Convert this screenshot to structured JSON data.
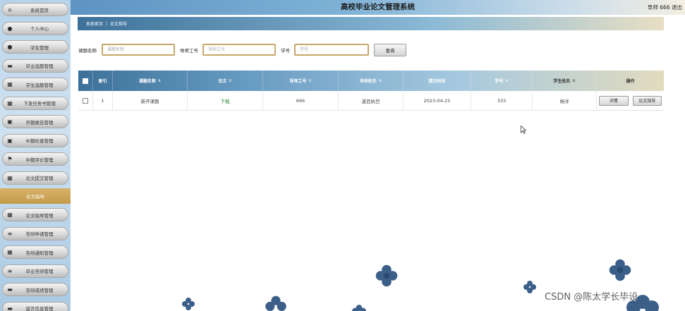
{
  "header": {
    "title": "高校毕业论文管理系统",
    "user": "导师 666 退出"
  },
  "breadcrumb": {
    "home": "系统首页",
    "current": "论文指导"
  },
  "sidebar": {
    "items": [
      {
        "label": "系统首页",
        "icon": "home-icon"
      },
      {
        "label": "个人中心",
        "icon": "user-icon"
      },
      {
        "label": "学生管理",
        "icon": "user-icon"
      },
      {
        "label": "毕业选题管理",
        "icon": "book-icon"
      },
      {
        "label": "学生选题管理",
        "icon": "grid-icon"
      },
      {
        "label": "下发任务书管理",
        "icon": "grid-icon"
      },
      {
        "label": "开题报告管理",
        "icon": "doc-icon"
      },
      {
        "label": "中期检查管理",
        "icon": "doc-icon"
      },
      {
        "label": "中期评价管理",
        "icon": "flag-icon"
      },
      {
        "label": "论文提交管理",
        "icon": "grid-icon"
      },
      {
        "label": "论文指导",
        "active": true
      },
      {
        "label": "论文指导管理",
        "icon": "grid-icon"
      },
      {
        "label": "答辩申请管理",
        "icon": "list-icon"
      },
      {
        "label": "答辩通知管理",
        "icon": "grid-icon"
      },
      {
        "label": "毕业答辩管理",
        "icon": "list-icon"
      },
      {
        "label": "答辩成绩管理",
        "icon": "book-icon"
      },
      {
        "label": "留言信息管理",
        "icon": "book-icon"
      }
    ]
  },
  "search": {
    "title_label": "课题名称",
    "title_placeholder": "课题名称",
    "tutor_label": "导师工号",
    "tutor_placeholder": "导师工号",
    "student_label": "学号",
    "student_placeholder": "学号",
    "button": "查询"
  },
  "table": {
    "headers": [
      "索引",
      "课题名称",
      "论文",
      "导师工号",
      "导师姓名",
      "提交时间",
      "学号",
      "学生姓名",
      "操作"
    ],
    "rows": [
      {
        "index": "1",
        "title": "新开课题",
        "paper": "下载",
        "tutor_id": "666",
        "tutor_name": "道百执巴",
        "time": "2023-04-25",
        "student_id": "333",
        "student_name": "杨洋",
        "btn_detail": "详情",
        "btn_guide": "论文指导"
      }
    ]
  },
  "watermark": "CSDN @陈太学长毕设",
  "colors": {
    "accent": "#3d7199",
    "active": "#c49a48",
    "input_border": "#c6a76b"
  }
}
